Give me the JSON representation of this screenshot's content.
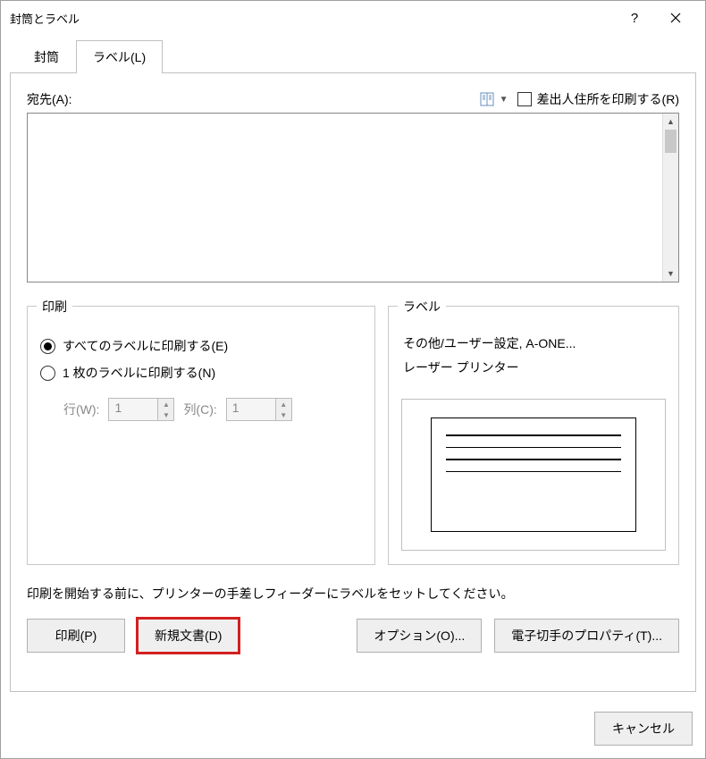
{
  "window": {
    "title": "封筒とラベル"
  },
  "tabs": {
    "envelope": "封筒",
    "label": "ラベル(L)"
  },
  "address": {
    "label": "宛先(A):",
    "return_checkbox_label": "差出人住所を印刷する(R)",
    "value": ""
  },
  "print_group": {
    "legend": "印刷",
    "opt_all": "すべてのラベルに印刷する(E)",
    "opt_one": "1 枚のラベルに印刷する(N)",
    "row_label": "行(W):",
    "row_value": "1",
    "col_label": "列(C):",
    "col_value": "1"
  },
  "label_group": {
    "legend": "ラベル",
    "line1": "その他/ユーザー設定, A-ONE...",
    "line2": "レーザー プリンター"
  },
  "hint": "印刷を開始する前に、プリンターの手差しフィーダーにラベルをセットしてください。",
  "buttons": {
    "print": "印刷(P)",
    "new_doc": "新規文書(D)",
    "options": "オプション(O)...",
    "stamp_props": "電子切手のプロパティ(T)...",
    "cancel": "キャンセル"
  }
}
